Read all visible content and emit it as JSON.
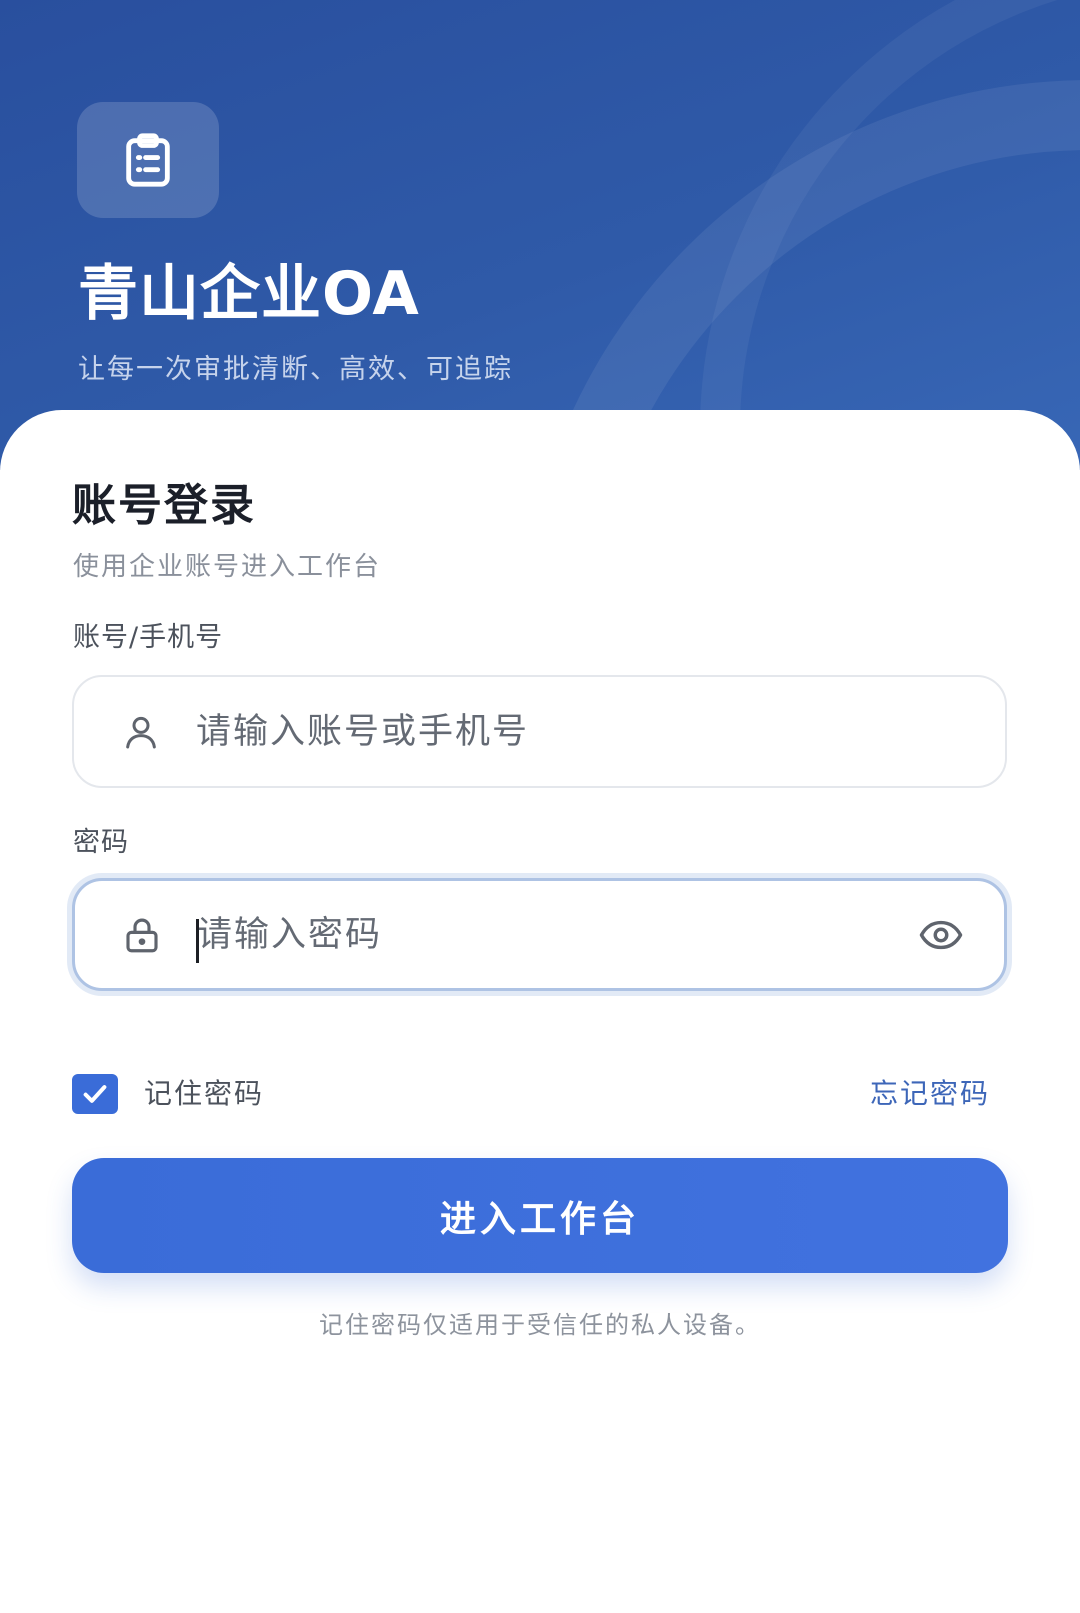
{
  "header": {
    "app_name": "青山企业OA",
    "tagline": "让每一次审批清断、高效、可追踪",
    "logo_icon": "clipboard-list-icon"
  },
  "login": {
    "title": "账号登录",
    "subtitle": "使用企业账号进入工作台",
    "account": {
      "label": "账号/手机号",
      "placeholder": "请输入账号或手机号",
      "value": "",
      "icon": "user-icon"
    },
    "password": {
      "label": "密码",
      "placeholder": "请输入密码",
      "value": "",
      "focused": true,
      "icon": "lock-icon",
      "toggle_icon": "eye-icon"
    },
    "remember": {
      "label": "记住密码",
      "checked": true
    },
    "forgot_label": "忘记密码",
    "submit_label": "进入工作台",
    "hint": "记住密码仅适用于受信任的私人设备。"
  },
  "colors": {
    "header_blue": "#2f5aa8",
    "primary": "#3a6cd8",
    "link": "#3d66b8",
    "title_text": "#1b1f29",
    "muted_text": "#8a909b"
  }
}
